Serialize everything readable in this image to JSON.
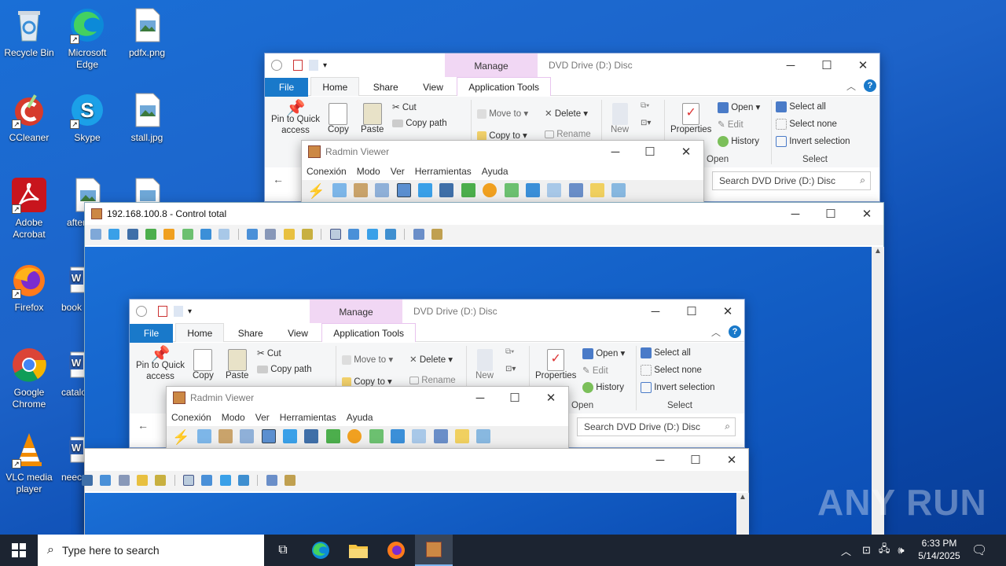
{
  "desktop": {
    "icons": [
      {
        "label": "Recycle Bin",
        "icon": "recycle-bin-icon"
      },
      {
        "label": "Microsoft Edge",
        "icon": "edge-icon"
      },
      {
        "label": "pdfx.png",
        "icon": "image-file-icon"
      },
      {
        "label": "CCleaner",
        "icon": "ccleaner-icon"
      },
      {
        "label": "Skype",
        "icon": "skype-icon"
      },
      {
        "label": "stall.jpg",
        "icon": "image-file-icon"
      },
      {
        "label": "Adobe Acrobat",
        "icon": "acrobat-icon"
      },
      {
        "label": "aftern",
        "icon": "image-file-icon"
      },
      {
        "label": "",
        "icon": "image-file-icon"
      },
      {
        "label": "Firefox",
        "icon": "firefox-icon"
      },
      {
        "label": "book",
        "icon": "word-doc-icon"
      },
      {
        "label": "Google Chrome",
        "icon": "chrome-icon"
      },
      {
        "label": "catalo",
        "icon": "word-doc-icon"
      },
      {
        "label": "VLC media player",
        "icon": "vlc-icon"
      },
      {
        "label": "neec",
        "icon": "word-doc-icon"
      }
    ]
  },
  "explorer": {
    "title": "DVD Drive (D:) Disc",
    "manage": "Manage",
    "tabs": [
      "File",
      "Home",
      "Share",
      "View",
      "Application Tools"
    ],
    "ribbon": {
      "pin": "Pin to Quick access",
      "copy": "Copy",
      "paste": "Paste",
      "cut": "Cut",
      "copy_path": "Copy path",
      "move_to": "Move to",
      "copy_to": "Copy to",
      "delete": "Delete",
      "rename": "Rename",
      "new": "New",
      "properties": "Properties",
      "open": "Open",
      "edit": "Edit",
      "history": "History",
      "select_all": "Select all",
      "select_none": "Select none",
      "invert": "Invert selection",
      "group_open": "Open",
      "group_select": "Select"
    },
    "search_placeholder": "Search DVD Drive (D:) Disc"
  },
  "radmin": {
    "title": "Radmin Viewer",
    "menu": [
      "Conexión",
      "Modo",
      "Ver",
      "Herramientas",
      "Ayuda"
    ]
  },
  "control": {
    "title": "192.168.100.8 - Control total"
  },
  "taskbar": {
    "search_placeholder": "Type here to search",
    "time": "6:33 PM",
    "date": "5/14/2025"
  },
  "watermark": "ANY RUN",
  "colors": {
    "accent": "#1979ca",
    "manage_tab": "#f1d7f4",
    "desktop": "#1d63c9",
    "taskbar": "#1c2431"
  }
}
